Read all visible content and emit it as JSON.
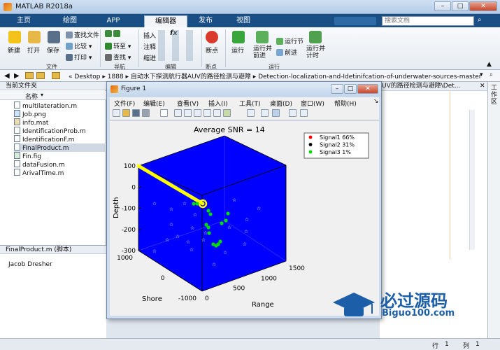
{
  "app": {
    "title": "MATLAB R2018a"
  },
  "tabs": [
    "主页",
    "绘图",
    "APP",
    "编辑器",
    "发布",
    "视图"
  ],
  "search": {
    "placeholder": "搜索文档"
  },
  "ribbon": {
    "new": "新建",
    "open": "打开",
    "save": "保存",
    "find_files": "查找文件",
    "compare": "比较",
    "print": "打印",
    "insert": "插入",
    "fx": "fx",
    "comment": "注释",
    "indent": "缩进",
    "goto": "转至",
    "find": "查找",
    "breakpoints": "断点",
    "run": "运行",
    "run_advance": "运行并\n前进",
    "run_section": "运行节",
    "advance": "前进",
    "run_time": "运行并\n计时",
    "groups": {
      "file": "文件",
      "navigate": "导航",
      "edit": "编辑",
      "breakpoints": "断点",
      "run": "运行"
    }
  },
  "address": {
    "segments": [
      "«",
      "Desktop",
      "1888",
      "自动水下探测航行器AUV的路径检测与避障",
      "Detection-localization-and-Idetinifcation-of-underwater-sources-master"
    ]
  },
  "left_panel": {
    "header": "当前文件夹",
    "column": "名称",
    "files": [
      "multilateration.m",
      "Job.png",
      "info.mat",
      "IdentificationProb.m",
      "IdentificationF.m",
      "FinalProduct.m",
      "Fin.fig",
      "dataFusion.m",
      "ArivalTime.m"
    ],
    "selected": "FinalProduct.m"
  },
  "detail": {
    "header": "FinalProduct.m  (脚本)",
    "author": "Jacob Dresher"
  },
  "background_editor": {
    "path_fragment": "UV的路径检测与避障\\Det..."
  },
  "right_strip": {
    "label": "工作区"
  },
  "figure": {
    "title": "Figure 1",
    "menu": [
      "文件(F)",
      "编辑(E)",
      "查看(V)",
      "插入(I)",
      "工具(T)",
      "桌面(D)",
      "窗口(W)",
      "帮助(H)"
    ]
  },
  "chart_data": {
    "type": "scatter",
    "title": "Average SNR = 14",
    "xlabel": "Range",
    "ylabel": "Shore",
    "zlabel": "Depth",
    "x_ticks": [
      "0",
      "500",
      "1000",
      "1500"
    ],
    "y_ticks": [
      "1000",
      "0",
      "-1000"
    ],
    "z_ticks": [
      "100",
      "0",
      "-100",
      "-200",
      "-300"
    ],
    "xlim": [
      0,
      1500
    ],
    "ylim": [
      -1000,
      1000
    ],
    "zlim": [
      -300,
      100
    ],
    "background": "#0000ff",
    "legend": {
      "placement": "top-right",
      "entries": [
        {
          "name": "Signal1 66%",
          "color": "#ff0000"
        },
        {
          "name": "Signal2 31%",
          "color": "#000000"
        },
        {
          "name": "Signal3 1%",
          "color": "#00dd00"
        }
      ]
    },
    "path_color": "#ffff00"
  },
  "status": {
    "row_label": "行",
    "row": "1",
    "col_label": "列",
    "col": "1"
  },
  "watermark": {
    "text": "必过源码",
    "sub": "Biguo100.com"
  }
}
